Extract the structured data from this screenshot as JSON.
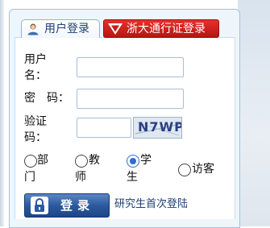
{
  "tabs": {
    "user_login": "用户登录",
    "zju_pass_login": "浙大通行证登录"
  },
  "form": {
    "username_label_1": "用户",
    "username_label_2": "名：",
    "username_value": "",
    "password_label": "密　码：",
    "password_value": "",
    "captcha_label_1": "验证",
    "captcha_label_2": "码：",
    "captcha_value": "",
    "captcha_text": "N7WP"
  },
  "roles": {
    "dept_1": "部",
    "dept_2": "门",
    "teacher_1": "教",
    "teacher_2": "师",
    "student_1": "学",
    "student_2": "生",
    "visitor": "访客",
    "selected": "student"
  },
  "actions": {
    "login": "登录",
    "first_login": "研究生首次登陆"
  },
  "colors": {
    "accent_blue": "#2c5a9e",
    "tab_red": "#d0201c",
    "panel_border": "#9ec3e3"
  }
}
